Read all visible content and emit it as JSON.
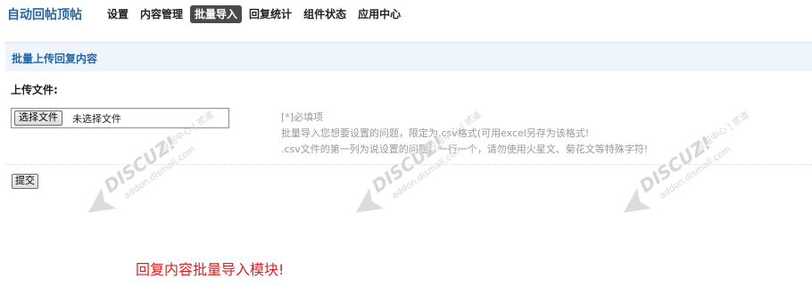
{
  "app": {
    "title": "自动回帖顶帖"
  },
  "nav": {
    "items": [
      {
        "label": "设置"
      },
      {
        "label": "内容管理"
      },
      {
        "label": "批量导入",
        "active": true
      },
      {
        "label": "回复统计"
      },
      {
        "label": "组件状态"
      },
      {
        "label": "应用中心"
      }
    ]
  },
  "section": {
    "title": "批量上传回复内容"
  },
  "form": {
    "upload_label": "上传文件:",
    "choose_file_button": "选择文件",
    "no_file_text": "未选择文件",
    "submit_button": "提交"
  },
  "tips": {
    "required": "[*]必填项",
    "line1": "批量导入您想要设置的问题，限定为.csv格式(可用excel另存为该格式!",
    "line2": ".csv文件的第一列为说设置的问题，一行一个，请勿使用火星文、菊花文等特殊字符!"
  },
  "caption": "回复内容批量导入模块!",
  "watermark": {
    "brand": "DISCUZ!",
    "line1": "应用中心 | 贰道",
    "line2": "addon.dismall.com"
  },
  "colors": {
    "accent": "#2366a8",
    "section_bg": "#eef5fd",
    "active_tab_bg": "#4a4a4a",
    "caption": "#e02020",
    "hint": "#999999"
  }
}
